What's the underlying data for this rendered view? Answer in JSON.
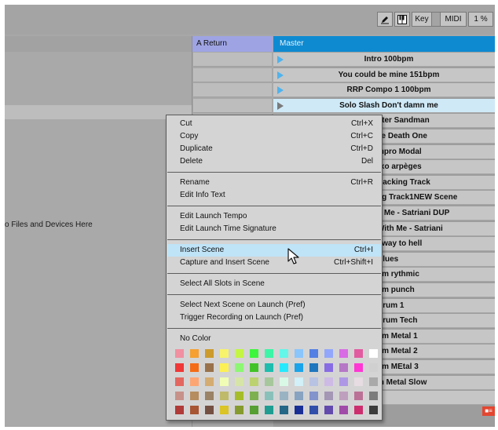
{
  "toolbar": {
    "pencil_icon": "pencil-icon",
    "keyboard_icon": "piano-keys-icon",
    "key_label": "Key",
    "midi_label": "MIDI",
    "cpu_label": "1 %"
  },
  "browser": {
    "drop_hint": "o Files and Devices Here"
  },
  "return_track": {
    "name": "A Return"
  },
  "master_track": {
    "name": "Master"
  },
  "scenes": [
    {
      "name": "Intro 100bpm"
    },
    {
      "name": "You could be mine 151bpm"
    },
    {
      "name": "RRP Compo 1  100bpm"
    },
    {
      "name": "Solo Slash Don't damn me"
    },
    {
      "name": "nter Sandman"
    },
    {
      "name": "ve Death One"
    },
    {
      "name": "mpro Modal"
    },
    {
      "name": "rxo arpèges"
    },
    {
      "name": "Backing Track"
    },
    {
      "name": "ng Track1NEW Scene"
    },
    {
      "name": "h Me - Satriani DUP"
    },
    {
      "name": "With Me - Satriani"
    },
    {
      "name": "hway to hell"
    },
    {
      "name": "Blues"
    },
    {
      "name": "um rythmic"
    },
    {
      "name": "um punch"
    },
    {
      "name": "Drum 1"
    },
    {
      "name": "Drum Tech"
    },
    {
      "name": "um Metal 1"
    },
    {
      "name": "um Metal 2"
    },
    {
      "name": "um MEtal 3"
    },
    {
      "name": "m Metal Slow"
    },
    {
      "name": ""
    }
  ],
  "stop_all_icon": "stop-all-clips-icon",
  "context_menu": {
    "groups": [
      [
        {
          "label": "Cut",
          "shortcut": "Ctrl+X"
        },
        {
          "label": "Copy",
          "shortcut": "Ctrl+C"
        },
        {
          "label": "Duplicate",
          "shortcut": "Ctrl+D"
        },
        {
          "label": "Delete",
          "shortcut": "Del"
        }
      ],
      [
        {
          "label": "Rename",
          "shortcut": "Ctrl+R"
        },
        {
          "label": "Edit Info Text",
          "shortcut": ""
        }
      ],
      [
        {
          "label": "Edit Launch Tempo",
          "shortcut": ""
        },
        {
          "label": "Edit Launch Time Signature",
          "shortcut": ""
        }
      ],
      [
        {
          "label": "Insert Scene",
          "shortcut": "Ctrl+I",
          "highlighted": true
        },
        {
          "label": "Capture and Insert Scene",
          "shortcut": "Ctrl+Shift+I"
        }
      ],
      [
        {
          "label": "Select All Slots in Scene",
          "shortcut": ""
        }
      ],
      [
        {
          "label": "Select Next Scene on Launch (Pref)",
          "shortcut": ""
        },
        {
          "label": "Trigger Recording on Launch (Pref)",
          "shortcut": ""
        }
      ],
      [
        {
          "label": "No Color",
          "shortcut": ""
        }
      ]
    ],
    "palette": [
      [
        "#f090a0",
        "#f5a030",
        "#cc9b2c",
        "#f7f36a",
        "#c4f545",
        "#3df53c",
        "#3cf5a6",
        "#63f6e9",
        "#8ac5fc",
        "#5480e3",
        "#92a7fb",
        "#d86ce4",
        "#e25ba0",
        "#ffffff"
      ],
      [
        "#ef3837",
        "#f46c16",
        "#99724b",
        "#fdf055",
        "#8df773",
        "#41c327",
        "#1ebdae",
        "#27e9fd",
        "#1ba4ea",
        "#1e76be",
        "#886ce4",
        "#b677c6",
        "#ff38d4",
        "#d0d0d0"
      ],
      [
        "#e3675f",
        "#fea574",
        "#d4ac71",
        "#f0fdb5",
        "#d6e5a7",
        "#bcd270",
        "#a6c79b",
        "#daf8e6",
        "#d1f0f7",
        "#b8c2e3",
        "#cdbae5",
        "#ae98e5",
        "#e6dce1",
        "#a9a9a9"
      ],
      [
        "#c7928a",
        "#b68d5f",
        "#9a8367",
        "#bfba6a",
        "#a6bd29",
        "#7eb050",
        "#89c1ba",
        "#9ab3c3",
        "#87a3c1",
        "#8393cc",
        "#a496b5",
        "#bf9fbe",
        "#bb7196",
        "#7c7c7c"
      ],
      [
        "#b03b38",
        "#a75533",
        "#745043",
        "#dbc425",
        "#869b2d",
        "#569f32",
        "#1f9d92",
        "#256787",
        "#1a2f95",
        "#314faa",
        "#624bad",
        "#a14ba9",
        "#cc2e6e",
        "#3c3c3c"
      ]
    ]
  }
}
